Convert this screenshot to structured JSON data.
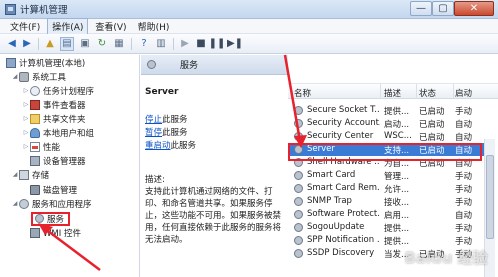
{
  "window": {
    "title": "计算机管理",
    "minimize_glyph": "—",
    "maximize_glyph": "▢",
    "close_glyph": "✕"
  },
  "menu": [
    "文件(F)",
    "操作(A)",
    "查看(V)",
    "帮助(H)"
  ],
  "tree": {
    "root": "计算机管理(本地)",
    "items": [
      {
        "label": "系统工具",
        "icon": "tools-icon"
      },
      {
        "label": "任务计划程序",
        "icon": "clock-icon"
      },
      {
        "label": "事件查看器",
        "icon": "event-viewer-icon"
      },
      {
        "label": "共享文件夹",
        "icon": "shared-folder-icon"
      },
      {
        "label": "本地用户和组",
        "icon": "users-icon"
      },
      {
        "label": "性能",
        "icon": "performance-icon"
      },
      {
        "label": "设备管理器",
        "icon": "device-manager-icon"
      },
      {
        "label": "存储",
        "icon": "storage-icon"
      },
      {
        "label": "磁盘管理",
        "icon": "disk-icon"
      },
      {
        "label": "服务和应用程序",
        "icon": "services-apps-icon"
      },
      {
        "label": "服务",
        "icon": "gear-icon"
      },
      {
        "label": "WMI 控件",
        "icon": "wmi-icon"
      }
    ]
  },
  "services_header": "服务",
  "detail": {
    "title": "Server",
    "links": [
      {
        "link": "停止",
        "text": "此服务"
      },
      {
        "link": "暂停",
        "text": "此服务"
      },
      {
        "link": "重启动",
        "text": "此服务"
      }
    ],
    "description_label": "描述:",
    "description": "支持此计算机通过网络的文件、打印、和命名管道共享。如果服务停止，这些功能不可用。如果服务被禁用，任何直接依赖于此服务的服务将无法启动。"
  },
  "list": {
    "columns": [
      "名称",
      "描述",
      "状态",
      "启动"
    ],
    "rows": [
      {
        "name": "Secure Socket T...",
        "desc": "提供...",
        "status": "已启动",
        "start": "手动"
      },
      {
        "name": "Security Account...",
        "desc": "启动...",
        "status": "已启动",
        "start": "自动"
      },
      {
        "name": "Security Center",
        "desc": "WSC...",
        "status": "已启动",
        "start": "自动"
      },
      {
        "name": "Server",
        "desc": "支持...",
        "status": "已启动",
        "start": "自动",
        "selected": true
      },
      {
        "name": "Shell Hardware ...",
        "desc": "为自...",
        "status": "已启动",
        "start": "自动"
      },
      {
        "name": "Smart Card",
        "desc": "管理...",
        "status": "",
        "start": "手动"
      },
      {
        "name": "Smart Card Rem...",
        "desc": "允许...",
        "status": "",
        "start": "手动"
      },
      {
        "name": "SNMP Trap",
        "desc": "接收...",
        "status": "",
        "start": "手动"
      },
      {
        "name": "Software Protect...",
        "desc": "启用...",
        "status": "",
        "start": "自动"
      },
      {
        "name": "SogouUpdate",
        "desc": "提供...",
        "status": "",
        "start": "手动"
      },
      {
        "name": "SPP Notification ...",
        "desc": "提供...",
        "status": "",
        "start": "手动"
      },
      {
        "name": "SSDP Discovery",
        "desc": "当发...",
        "status": "已启动",
        "start": "手动"
      }
    ]
  },
  "watermark": "Baidu 经验",
  "colors": {
    "highlight_red": "#e8222d",
    "selection_blue": "#3a7bd5",
    "link_blue": "#0b52c4"
  }
}
